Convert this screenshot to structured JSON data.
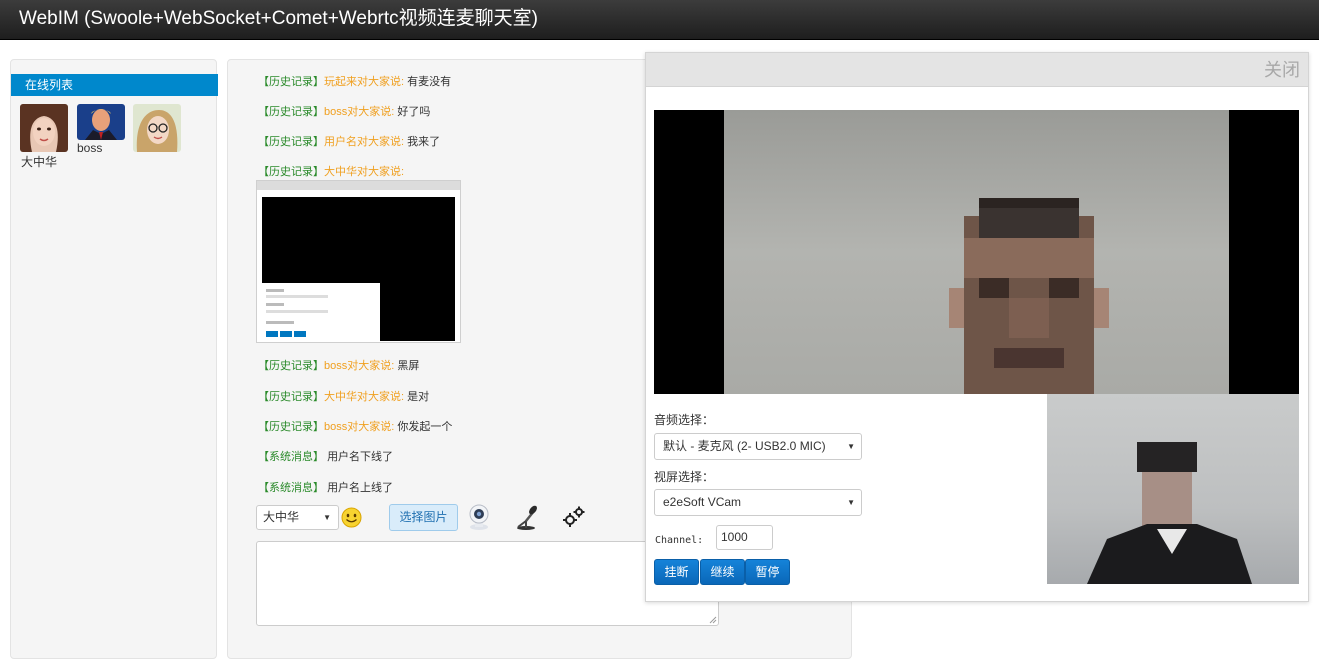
{
  "app": {
    "title": "WebIM (Swoole+WebSocket+Comet+Webrtc视频连麦聊天室)"
  },
  "sidebar": {
    "title": "在线列表",
    "users": [
      {
        "name": "大中华",
        "avatar": "avatar-girl-1"
      },
      {
        "name": "boss",
        "avatar": "avatar-man-suit"
      },
      {
        "name": "",
        "avatar": "avatar-girl-glasses"
      }
    ]
  },
  "chat": {
    "messages": [
      {
        "tag": "【历史记录】",
        "who": "玩起来对大家说:",
        "text": "有麦没有"
      },
      {
        "tag": "【历史记录】",
        "who": "boss对大家说:",
        "text": "好了吗"
      },
      {
        "tag": "【历史记录】",
        "who": "用户名对大家说:",
        "text": "我来了"
      },
      {
        "tag": "【历史记录】",
        "who": "大中华对大家说:",
        "text": ""
      },
      {
        "tag": "【历史记录】",
        "who": "boss对大家说:",
        "text": "黑屏"
      },
      {
        "tag": "【历史记录】",
        "who": "大中华对大家说:",
        "text": "是对"
      },
      {
        "tag": "【历史记录】",
        "who": "boss对大家说:",
        "text": "你发起一个"
      },
      {
        "tag": "【系统消息】",
        "who": "",
        "text": "用户名下线了"
      },
      {
        "tag": "【系统消息】",
        "who": "",
        "text": "用户名上线了"
      }
    ],
    "toolbar": {
      "user_select": "大中华",
      "choose_image": "选择图片",
      "icons": [
        "smiley-icon",
        "webcam-icon",
        "microphone-icon",
        "settings-gears-icon"
      ]
    },
    "input_value": ""
  },
  "video_dialog": {
    "close_label": "关闭",
    "audio_label": "音频选择：",
    "audio_value": "默认 - 麦克风 (2- USB2.0 MIC)",
    "video_label": "视屏选择：",
    "video_value": "e2eSoft VCam",
    "channel_label": "Channel:",
    "channel_value": "1000",
    "buttons": {
      "hangup": "挂断",
      "resume": "继续",
      "pause": "暂停"
    }
  },
  "colors": {
    "accent": "#0088cc",
    "history_tag": "#2a8a2a",
    "speaker": "#f0a020",
    "button_blue": "#0a67b8"
  }
}
